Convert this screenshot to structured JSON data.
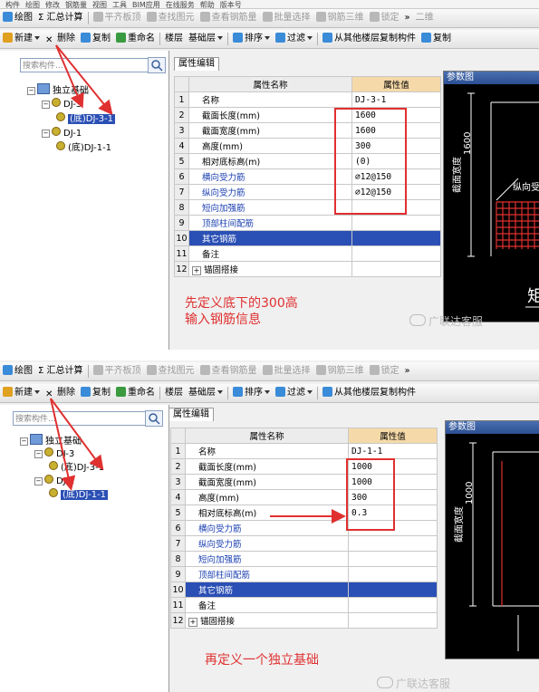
{
  "screens": [
    {
      "menu": [
        "构件",
        "绘图",
        "修改",
        "钢筋量",
        "视图",
        "工具",
        "BIM应用",
        "在线服务",
        "帮助",
        "版本号"
      ],
      "toolbar1": [
        {
          "label": "绘图",
          "icon": "draw-icon",
          "disabled": false
        },
        {
          "label": "Σ 汇总计算",
          "icon": "",
          "disabled": false
        },
        {
          "label": "平齐板顶",
          "icon": "align-slab-icon",
          "disabled": true
        },
        {
          "label": "查找图元",
          "icon": "find-element-icon",
          "disabled": true
        },
        {
          "label": "查看钢筋量",
          "icon": "view-rebar-icon",
          "disabled": true
        },
        {
          "label": "批量选择",
          "icon": "batch-select-icon",
          "disabled": true
        },
        {
          "label": "钢筋三维",
          "icon": "rebar-3d-icon",
          "disabled": true
        },
        {
          "label": "锁定",
          "icon": "lock-icon",
          "disabled": true
        },
        {
          "label": "»",
          "icon": "",
          "disabled": false
        },
        {
          "label": "二维",
          "icon": "",
          "disabled": true
        }
      ],
      "toolbar2": [
        {
          "label": "新建",
          "icon": "new-icon",
          "dropdown": true
        },
        {
          "label": "删除",
          "icon": "delete-icon",
          "dropdown": false
        },
        {
          "label": "复制",
          "icon": "copy-icon",
          "dropdown": false
        },
        {
          "label": "重命名",
          "icon": "rename-icon",
          "dropdown": false
        },
        {
          "label": "楼层",
          "icon": "",
          "dropdown": false
        },
        {
          "label": "基础层",
          "icon": "",
          "dropdown": true
        },
        {
          "label": "排序",
          "icon": "sort-icon",
          "dropdown": true
        },
        {
          "label": "过滤",
          "icon": "filter-icon",
          "dropdown": true
        },
        {
          "label": "从其他楼层复制构件",
          "icon": "copy-floor-icon",
          "dropdown": false
        },
        {
          "label": "复制",
          "icon": "copy2-icon",
          "dropdown": false
        }
      ],
      "search_placeholder": "搜索构件...",
      "tree": [
        {
          "label": "独立基础",
          "level": 0,
          "type": "root",
          "selected": false
        },
        {
          "label": "DJ-3",
          "level": 1,
          "type": "gear",
          "selected": false
        },
        {
          "label": "(底)DJ-3-1",
          "level": 2,
          "type": "gear",
          "selected": true
        },
        {
          "label": "DJ-1",
          "level": 1,
          "type": "gear",
          "selected": false
        },
        {
          "label": "(底)DJ-1-1",
          "level": 2,
          "type": "gear",
          "selected": false
        }
      ],
      "tab_label": "属性编辑",
      "table_header": {
        "name": "属性名称",
        "value": "属性值"
      },
      "rows": [
        {
          "num": "1",
          "name": "名称",
          "value": "DJ-3-1",
          "blue": false,
          "expand": false,
          "selected": false
        },
        {
          "num": "2",
          "name": "截面长度(mm)",
          "value": "1600",
          "blue": false,
          "expand": false,
          "selected": false
        },
        {
          "num": "3",
          "name": "截面宽度(mm)",
          "value": "1600",
          "blue": false,
          "expand": false,
          "selected": false
        },
        {
          "num": "4",
          "name": "高度(mm)",
          "value": "300",
          "blue": false,
          "expand": false,
          "selected": false
        },
        {
          "num": "5",
          "name": "相对底标高(m)",
          "value": "(0)",
          "blue": false,
          "expand": false,
          "selected": false
        },
        {
          "num": "6",
          "name": "横向受力筋",
          "value": "⌀12@150",
          "blue": true,
          "expand": false,
          "selected": false
        },
        {
          "num": "7",
          "name": "纵向受力筋",
          "value": "⌀12@150",
          "blue": true,
          "expand": false,
          "selected": false
        },
        {
          "num": "8",
          "name": "短向加强筋",
          "value": "",
          "blue": true,
          "expand": false,
          "selected": false
        },
        {
          "num": "9",
          "name": "顶部柱间配筋",
          "value": "",
          "blue": true,
          "expand": false,
          "selected": false
        },
        {
          "num": "10",
          "name": "其它钢筋",
          "value": "",
          "blue": false,
          "expand": false,
          "selected": true
        },
        {
          "num": "11",
          "name": "备注",
          "value": "",
          "blue": false,
          "expand": false,
          "selected": false
        },
        {
          "num": "12",
          "name": "锚固搭接",
          "value": "",
          "blue": false,
          "expand": true,
          "selected": false
        }
      ],
      "figure": {
        "title": "参数图",
        "dimension": "1600",
        "label_width": "截面宽度",
        "label_rebar": "纵向受",
        "label_big": "矩"
      },
      "note_lines": [
        "先定义底下的300高",
        "输入钢筋信息"
      ],
      "watermark": "广联达客服"
    },
    {
      "menu": [],
      "toolbar1": [
        {
          "label": "绘图",
          "icon": "draw-icon",
          "disabled": false
        },
        {
          "label": "Σ 汇总计算",
          "icon": "",
          "disabled": false
        },
        {
          "label": "平齐板顶",
          "icon": "align-slab-icon",
          "disabled": true
        },
        {
          "label": "查找图元",
          "icon": "find-element-icon",
          "disabled": true
        },
        {
          "label": "查看钢筋量",
          "icon": "view-rebar-icon",
          "disabled": true
        },
        {
          "label": "批量选择",
          "icon": "batch-select-icon",
          "disabled": true
        },
        {
          "label": "钢筋三维",
          "icon": "rebar-3d-icon",
          "disabled": true
        },
        {
          "label": "锁定",
          "icon": "lock-icon",
          "disabled": true
        },
        {
          "label": "»",
          "icon": "",
          "disabled": false
        }
      ],
      "toolbar2": [
        {
          "label": "新建",
          "icon": "new-icon",
          "dropdown": true
        },
        {
          "label": "删除",
          "icon": "delete-icon",
          "dropdown": false
        },
        {
          "label": "复制",
          "icon": "copy-icon",
          "dropdown": false
        },
        {
          "label": "重命名",
          "icon": "rename-icon",
          "dropdown": false
        },
        {
          "label": "楼层",
          "icon": "",
          "dropdown": false
        },
        {
          "label": "基础层",
          "icon": "",
          "dropdown": true
        },
        {
          "label": "排序",
          "icon": "sort-icon",
          "dropdown": true
        },
        {
          "label": "过滤",
          "icon": "filter-icon",
          "dropdown": true
        },
        {
          "label": "从其他楼层复制构件",
          "icon": "copy-floor-icon",
          "dropdown": false
        }
      ],
      "search_placeholder": "搜索构件...",
      "tree": [
        {
          "label": "独立基础",
          "level": 0,
          "type": "root",
          "selected": false
        },
        {
          "label": "DJ-3",
          "level": 1,
          "type": "gear",
          "selected": false
        },
        {
          "label": "(底)DJ-3-1",
          "level": 2,
          "type": "gear",
          "selected": false
        },
        {
          "label": "DJ-1",
          "level": 1,
          "type": "gear",
          "selected": false
        },
        {
          "label": "(底)DJ-1-1",
          "level": 2,
          "type": "gear",
          "selected": true
        }
      ],
      "tab_label": "属性编辑",
      "table_header": {
        "name": "属性名称",
        "value": "属性值"
      },
      "rows": [
        {
          "num": "1",
          "name": "名称",
          "value": "DJ-1-1",
          "blue": false,
          "expand": false,
          "selected": false
        },
        {
          "num": "2",
          "name": "截面长度(mm)",
          "value": "1000",
          "blue": false,
          "expand": false,
          "selected": false
        },
        {
          "num": "3",
          "name": "截面宽度(mm)",
          "value": "1000",
          "blue": false,
          "expand": false,
          "selected": false
        },
        {
          "num": "4",
          "name": "高度(mm)",
          "value": "300",
          "blue": false,
          "expand": false,
          "selected": false
        },
        {
          "num": "5",
          "name": "相对底标高(m)",
          "value": "0.3",
          "blue": false,
          "expand": false,
          "selected": false
        },
        {
          "num": "6",
          "name": "横向受力筋",
          "value": "",
          "blue": true,
          "expand": false,
          "selected": false
        },
        {
          "num": "7",
          "name": "纵向受力筋",
          "value": "",
          "blue": true,
          "expand": false,
          "selected": false
        },
        {
          "num": "8",
          "name": "短向加强筋",
          "value": "",
          "blue": true,
          "expand": false,
          "selected": false
        },
        {
          "num": "9",
          "name": "顶部柱间配筋",
          "value": "",
          "blue": true,
          "expand": false,
          "selected": false
        },
        {
          "num": "10",
          "name": "其它钢筋",
          "value": "",
          "blue": false,
          "expand": false,
          "selected": true
        },
        {
          "num": "11",
          "name": "备注",
          "value": "",
          "blue": false,
          "expand": false,
          "selected": false
        },
        {
          "num": "12",
          "name": "锚固搭接",
          "value": "",
          "blue": false,
          "expand": true,
          "selected": false
        }
      ],
      "figure": {
        "title": "参数图",
        "dimension": "1000",
        "label_width": "截面宽度",
        "label_rebar": "",
        "label_big": ""
      },
      "note_lines": [
        "再定义一个独立基础"
      ],
      "watermark": "广联达客服"
    }
  ],
  "colors": {
    "annotation": "#e03030",
    "selection": "#2a4fb5",
    "header_value": "#f5d9a8",
    "rebar_grid": "#e03030"
  }
}
